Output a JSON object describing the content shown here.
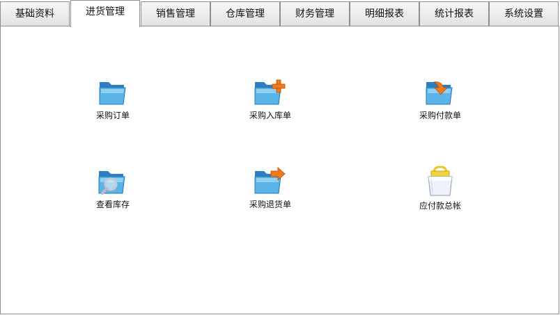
{
  "tabs": [
    {
      "label": "基础资料",
      "active": false
    },
    {
      "label": "进货管理",
      "active": true
    },
    {
      "label": "销售管理",
      "active": false
    },
    {
      "label": "仓库管理",
      "active": false
    },
    {
      "label": "财务管理",
      "active": false
    },
    {
      "label": "明细报表",
      "active": false
    },
    {
      "label": "统计报表",
      "active": false
    },
    {
      "label": "系统设置",
      "active": false
    }
  ],
  "items": [
    {
      "label": "采购订单",
      "icon": "folder-icon"
    },
    {
      "label": "采购入库单",
      "icon": "folder-add-icon"
    },
    {
      "label": "采购付款单",
      "icon": "folder-download-icon"
    },
    {
      "label": "查看库存",
      "icon": "folder-search-icon"
    },
    {
      "label": "采购退货单",
      "icon": "folder-forward-icon"
    },
    {
      "label": "应付款总帐",
      "icon": "shopping-bag-icon"
    }
  ],
  "colors": {
    "folder_blue": "#4fa9e0",
    "arrow_orange": "#f07a1a",
    "bag_yellow": "#f2d23a"
  }
}
